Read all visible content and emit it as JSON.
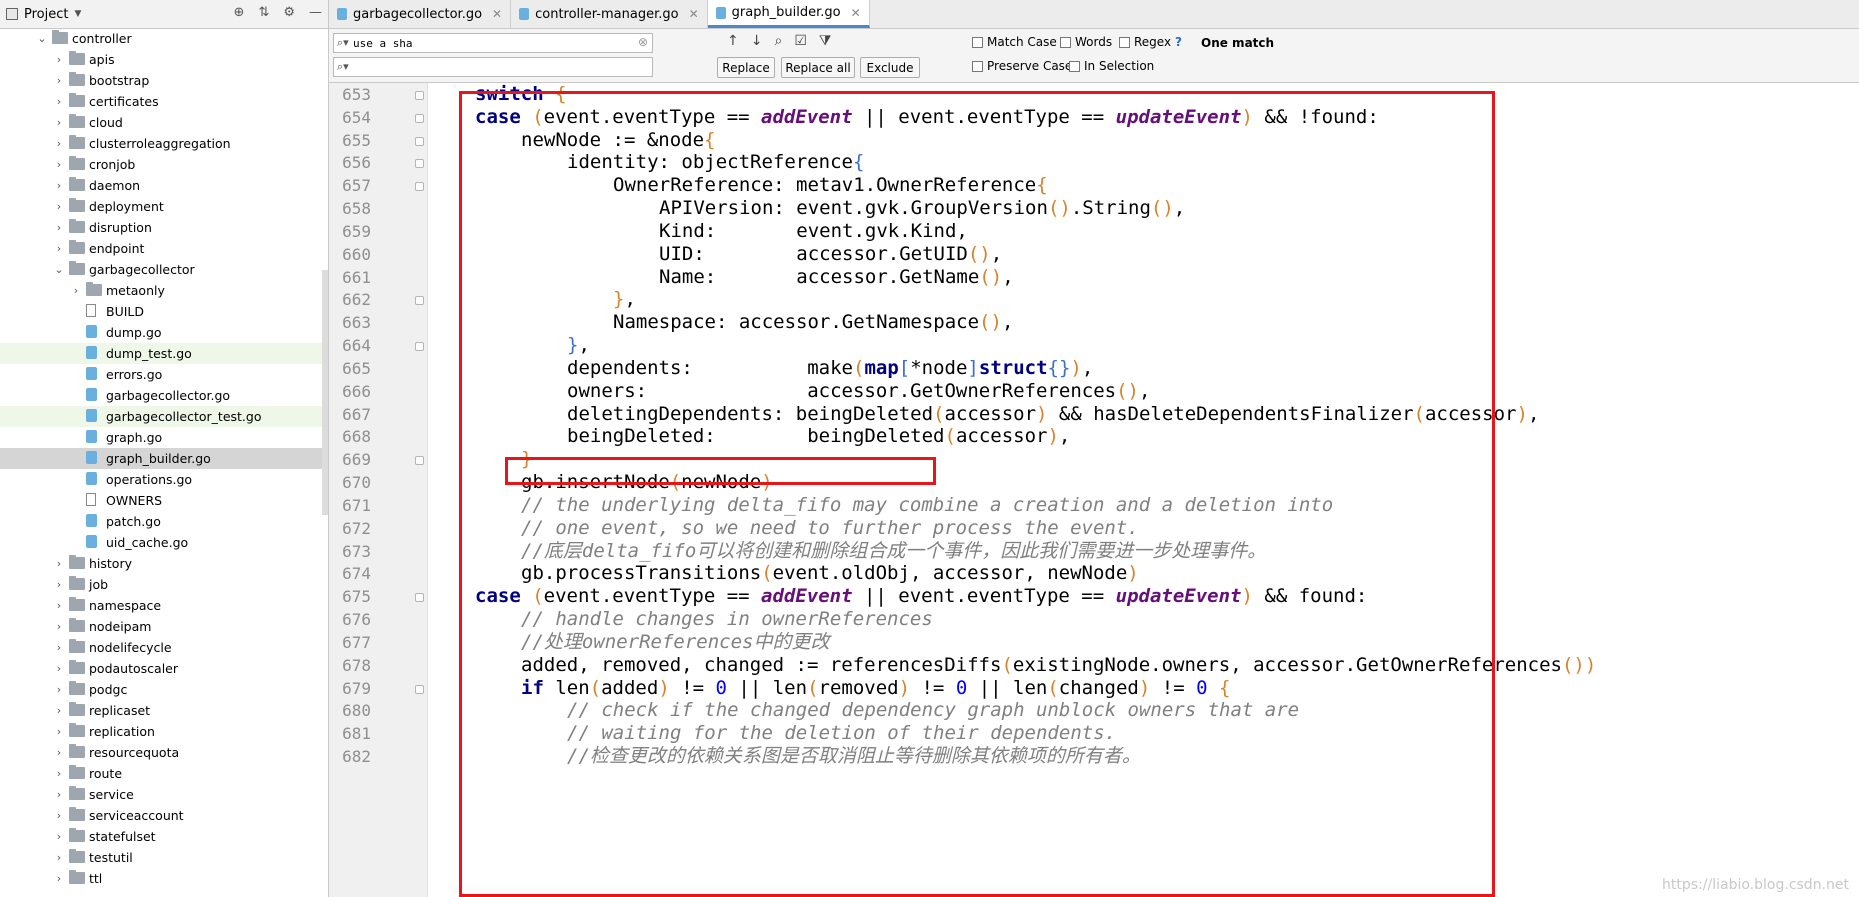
{
  "project": {
    "title": "Project",
    "tree": [
      {
        "label": "controller",
        "depth": 0,
        "expanded": true,
        "type": "folder"
      },
      {
        "label": "apis",
        "depth": 1,
        "type": "folder"
      },
      {
        "label": "bootstrap",
        "depth": 1,
        "type": "folder"
      },
      {
        "label": "certificates",
        "depth": 1,
        "type": "folder"
      },
      {
        "label": "cloud",
        "depth": 1,
        "type": "folder"
      },
      {
        "label": "clusterroleaggregation",
        "depth": 1,
        "type": "folder"
      },
      {
        "label": "cronjob",
        "depth": 1,
        "type": "folder"
      },
      {
        "label": "daemon",
        "depth": 1,
        "type": "folder"
      },
      {
        "label": "deployment",
        "depth": 1,
        "type": "folder"
      },
      {
        "label": "disruption",
        "depth": 1,
        "type": "folder"
      },
      {
        "label": "endpoint",
        "depth": 1,
        "type": "folder"
      },
      {
        "label": "garbagecollector",
        "depth": 1,
        "expanded": true,
        "type": "folder"
      },
      {
        "label": "metaonly",
        "depth": 2,
        "type": "folder"
      },
      {
        "label": "BUILD",
        "depth": 2,
        "type": "text"
      },
      {
        "label": "dump.go",
        "depth": 2,
        "type": "go"
      },
      {
        "label": "dump_test.go",
        "depth": 2,
        "type": "go",
        "highlight": true
      },
      {
        "label": "errors.go",
        "depth": 2,
        "type": "go"
      },
      {
        "label": "garbagecollector.go",
        "depth": 2,
        "type": "go"
      },
      {
        "label": "garbagecollector_test.go",
        "depth": 2,
        "type": "go",
        "highlight": true
      },
      {
        "label": "graph.go",
        "depth": 2,
        "type": "go"
      },
      {
        "label": "graph_builder.go",
        "depth": 2,
        "type": "go",
        "selected": true
      },
      {
        "label": "operations.go",
        "depth": 2,
        "type": "go"
      },
      {
        "label": "OWNERS",
        "depth": 2,
        "type": "text"
      },
      {
        "label": "patch.go",
        "depth": 2,
        "type": "go"
      },
      {
        "label": "uid_cache.go",
        "depth": 2,
        "type": "go"
      },
      {
        "label": "history",
        "depth": 1,
        "type": "folder"
      },
      {
        "label": "job",
        "depth": 1,
        "type": "folder"
      },
      {
        "label": "namespace",
        "depth": 1,
        "type": "folder"
      },
      {
        "label": "nodeipam",
        "depth": 1,
        "type": "folder"
      },
      {
        "label": "nodelifecycle",
        "depth": 1,
        "type": "folder"
      },
      {
        "label": "podautoscaler",
        "depth": 1,
        "type": "folder"
      },
      {
        "label": "podgc",
        "depth": 1,
        "type": "folder"
      },
      {
        "label": "replicaset",
        "depth": 1,
        "type": "folder"
      },
      {
        "label": "replication",
        "depth": 1,
        "type": "folder"
      },
      {
        "label": "resourcequota",
        "depth": 1,
        "type": "folder"
      },
      {
        "label": "route",
        "depth": 1,
        "type": "folder"
      },
      {
        "label": "service",
        "depth": 1,
        "type": "folder"
      },
      {
        "label": "serviceaccount",
        "depth": 1,
        "type": "folder"
      },
      {
        "label": "statefulset",
        "depth": 1,
        "type": "folder"
      },
      {
        "label": "testutil",
        "depth": 1,
        "type": "folder"
      },
      {
        "label": "ttl",
        "depth": 1,
        "type": "folder"
      }
    ]
  },
  "tabs": [
    {
      "label": "garbagecollector.go",
      "active": false
    },
    {
      "label": "controller-manager.go",
      "active": false
    },
    {
      "label": "graph_builder.go",
      "active": true
    }
  ],
  "find": {
    "search_value": "use a sha",
    "replace_value": "",
    "replace_label": "Replace",
    "replace_all_label": "Replace all",
    "exclude_label": "Exclude",
    "match_case": "Match Case",
    "words": "Words",
    "regex": "Regex",
    "help": "?",
    "preserve_case": "Preserve Case",
    "in_selection": "In Selection",
    "result": "One match"
  },
  "editor": {
    "lines": [
      {
        "n": "653",
        "html": "<span class='kw'>switch</span> <span class='br'>{</span>",
        "indent": 0
      },
      {
        "n": "654",
        "html": "<span class='kw'>case</span> <span class='br'>(</span>event.eventType == <span class='cn'>addEvent</span> || event.eventType == <span class='cn'>updateEvent</span><span class='br'>)</span> &amp;&amp; !found:",
        "indent": 0
      },
      {
        "n": "655",
        "html": "newNode := &amp;node<span class='br'>{</span>",
        "indent": 1
      },
      {
        "n": "656",
        "html": "identity: objectReference<span class='b2'>{</span>",
        "indent": 2
      },
      {
        "n": "657",
        "html": "OwnerReference: metav1.OwnerReference<span class='br'>{</span>",
        "indent": 3
      },
      {
        "n": "658",
        "html": "APIVersion: event.gvk.GroupVersion<span class='br'>()</span>.String<span class='br'>()</span>,",
        "indent": 4
      },
      {
        "n": "659",
        "html": "Kind:       event.gvk.Kind,",
        "indent": 4
      },
      {
        "n": "660",
        "html": "UID:        accessor.GetUID<span class='br'>()</span>,",
        "indent": 4
      },
      {
        "n": "661",
        "html": "Name:       accessor.GetName<span class='br'>()</span>,",
        "indent": 4
      },
      {
        "n": "662",
        "html": "<span class='br'>}</span>,",
        "indent": 3
      },
      {
        "n": "663",
        "html": "Namespace: accessor.GetNamespace<span class='br'>()</span>,",
        "indent": 3
      },
      {
        "n": "664",
        "html": "<span class='b2'>}</span>,",
        "indent": 2
      },
      {
        "n": "665",
        "html": "dependents:          make<span class='br'>(</span><span class='kw'>map</span><span class='b2'>[</span>*node<span class='b2'>]</span><span class='kw'>struct</span><span class='b2'>{}</span><span class='br'>)</span>,",
        "indent": 2
      },
      {
        "n": "666",
        "html": "owners:              accessor.GetOwnerReferences<span class='br'>()</span>,",
        "indent": 2
      },
      {
        "n": "667",
        "html": "deletingDependents: beingDeleted<span class='br'>(</span>accessor<span class='br'>)</span> &amp;&amp; hasDeleteDependentsFinalizer<span class='br'>(</span>accessor<span class='br'>)</span>,",
        "indent": 2
      },
      {
        "n": "668",
        "html": "beingDeleted:        beingDeleted<span class='br'>(</span>accessor<span class='br'>)</span>,",
        "indent": 2
      },
      {
        "n": "669",
        "html": "<span class='br'>}</span>",
        "indent": 1
      },
      {
        "n": "670",
        "html": "gb.insertNode<span class='br'>(</span>newNode<span class='br'>)</span>",
        "indent": 1
      },
      {
        "n": "671",
        "html": "<span class='cm'>// the underlying delta_fifo may combine a creation and a deletion into</span>",
        "indent": 1
      },
      {
        "n": "672",
        "html": "<span class='cm'>// one event, so we need to further process the event.</span>",
        "indent": 1
      },
      {
        "n": "673",
        "html": "<span class='cm'>//底层delta_fifo可以将创建和删除组合成一个事件，因此我们需要进一步处理事件。</span>",
        "indent": 1
      },
      {
        "n": "674",
        "html": "gb.processTransitions<span class='br'>(</span>event.oldObj, accessor, newNode<span class='br'>)</span>",
        "indent": 1
      },
      {
        "n": "675",
        "html": "<span class='kw'>case</span> <span class='br'>(</span>event.eventType == <span class='cn'>addEvent</span> || event.eventType == <span class='cn'>updateEvent</span><span class='br'>)</span> &amp;&amp; found:",
        "indent": 0
      },
      {
        "n": "676",
        "html": "<span class='cm'>// handle changes in ownerReferences</span>",
        "indent": 1
      },
      {
        "n": "677",
        "html": "<span class='cm'>//处理ownerReferences中的更改</span>",
        "indent": 1
      },
      {
        "n": "678",
        "html": "added, removed, changed := referencesDiffs<span class='br'>(</span>existingNode.owners, accessor.GetOwnerReferences<span class='br'>())</span>",
        "indent": 1
      },
      {
        "n": "679",
        "html": "<span class='kw'>if</span> len<span class='br'>(</span>added<span class='br'>)</span> != <span class='nm'>0</span> || len<span class='br'>(</span>removed<span class='br'>)</span> != <span class='nm'>0</span> || len<span class='br'>(</span>changed<span class='br'>)</span> != <span class='nm'>0</span> <span class='br'>{</span>",
        "indent": 1
      },
      {
        "n": "680",
        "html": "<span class='cm'>// check if the changed dependency graph unblock owners that are</span>",
        "indent": 2
      },
      {
        "n": "681",
        "html": "<span class='cm'>// waiting for the deletion of their dependents.</span>",
        "indent": 2
      },
      {
        "n": "682",
        "html": "<span class='cm'>//检查更改的依赖关系图是否取消阻止等待删除其依赖项的所有者。</span>",
        "indent": 2
      }
    ]
  },
  "watermark": "https://liabio.blog.csdn.net",
  "colors": {
    "annotation": "#e8161a",
    "keyword": "#000080",
    "constant": "#660e7a",
    "comment": "#808080"
  }
}
